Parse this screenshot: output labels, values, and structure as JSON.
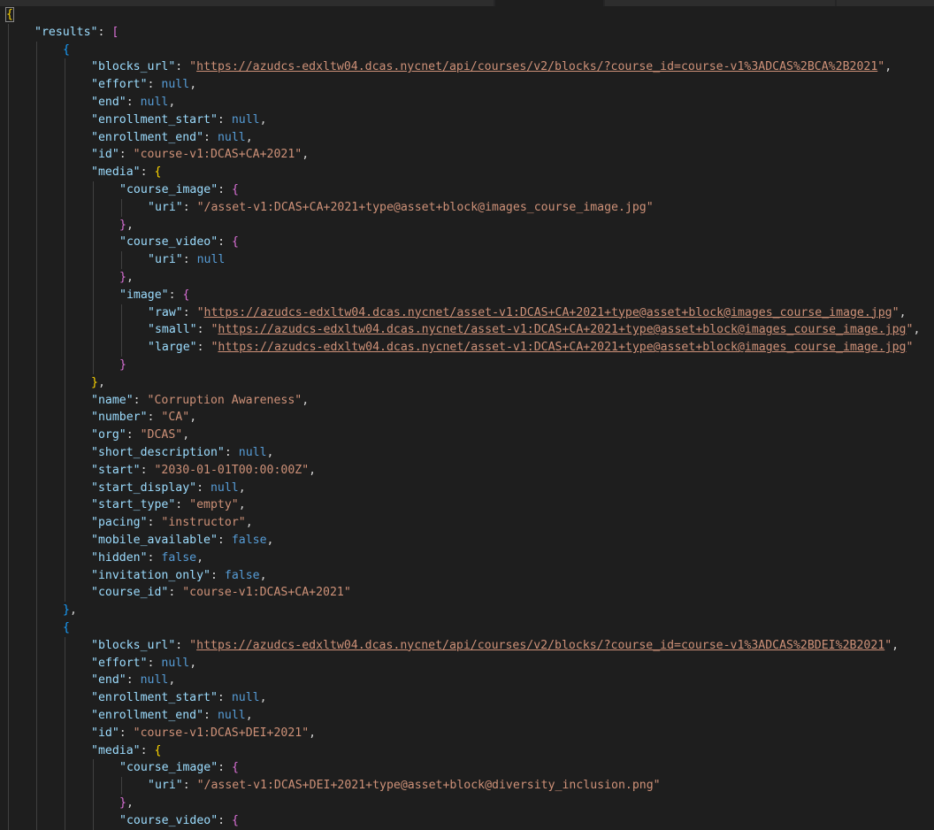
{
  "lines": [
    [
      [
        "b",
        "{"
      ]
    ],
    [
      [
        "k",
        "\"results\""
      ],
      [
        "p",
        ": "
      ],
      [
        "b2",
        "["
      ]
    ],
    [
      [
        "b3",
        "{"
      ]
    ],
    [
      [
        "k",
        "\"blocks_url\""
      ],
      [
        "p",
        ": "
      ],
      [
        "s",
        "\""
      ],
      [
        "su",
        "https://azudcs-edxltw04.dcas.nycnet/api/courses/v2/blocks/?course_id=course-v1%3ADCAS%2BCA%2B2021"
      ],
      [
        "s",
        "\""
      ],
      [
        "p",
        ","
      ]
    ],
    [
      [
        "k",
        "\"effort\""
      ],
      [
        "p",
        ": "
      ],
      [
        "n",
        "null"
      ],
      [
        "p",
        ","
      ]
    ],
    [
      [
        "k",
        "\"end\""
      ],
      [
        "p",
        ": "
      ],
      [
        "n",
        "null"
      ],
      [
        "p",
        ","
      ]
    ],
    [
      [
        "k",
        "\"enrollment_start\""
      ],
      [
        "p",
        ": "
      ],
      [
        "n",
        "null"
      ],
      [
        "p",
        ","
      ]
    ],
    [
      [
        "k",
        "\"enrollment_end\""
      ],
      [
        "p",
        ": "
      ],
      [
        "n",
        "null"
      ],
      [
        "p",
        ","
      ]
    ],
    [
      [
        "k",
        "\"id\""
      ],
      [
        "p",
        ": "
      ],
      [
        "s",
        "\"course-v1:DCAS+CA+2021\""
      ],
      [
        "p",
        ","
      ]
    ],
    [
      [
        "k",
        "\"media\""
      ],
      [
        "p",
        ": "
      ],
      [
        "b",
        "{"
      ]
    ],
    [
      [
        "k",
        "\"course_image\""
      ],
      [
        "p",
        ": "
      ],
      [
        "b2",
        "{"
      ]
    ],
    [
      [
        "k",
        "\"uri\""
      ],
      [
        "p",
        ": "
      ],
      [
        "s",
        "\"/asset-v1:DCAS+CA+2021+type@asset+block@images_course_image.jpg\""
      ]
    ],
    [
      [
        "b2",
        "}"
      ],
      [
        "p",
        ","
      ]
    ],
    [
      [
        "k",
        "\"course_video\""
      ],
      [
        "p",
        ": "
      ],
      [
        "b2",
        "{"
      ]
    ],
    [
      [
        "k",
        "\"uri\""
      ],
      [
        "p",
        ": "
      ],
      [
        "n",
        "null"
      ]
    ],
    [
      [
        "b2",
        "}"
      ],
      [
        "p",
        ","
      ]
    ],
    [
      [
        "k",
        "\"image\""
      ],
      [
        "p",
        ": "
      ],
      [
        "b2",
        "{"
      ]
    ],
    [
      [
        "k",
        "\"raw\""
      ],
      [
        "p",
        ": "
      ],
      [
        "s",
        "\""
      ],
      [
        "su",
        "https://azudcs-edxltw04.dcas.nycnet/asset-v1:DCAS+CA+2021+type@asset+block@images_course_image.jpg"
      ],
      [
        "s",
        "\""
      ],
      [
        "p",
        ","
      ]
    ],
    [
      [
        "k",
        "\"small\""
      ],
      [
        "p",
        ": "
      ],
      [
        "s",
        "\""
      ],
      [
        "su",
        "https://azudcs-edxltw04.dcas.nycnet/asset-v1:DCAS+CA+2021+type@asset+block@images_course_image.jpg"
      ],
      [
        "s",
        "\""
      ],
      [
        "p",
        ","
      ]
    ],
    [
      [
        "k",
        "\"large\""
      ],
      [
        "p",
        ": "
      ],
      [
        "s",
        "\""
      ],
      [
        "su",
        "https://azudcs-edxltw04.dcas.nycnet/asset-v1:DCAS+CA+2021+type@asset+block@images_course_image.jpg"
      ],
      [
        "s",
        "\""
      ]
    ],
    [
      [
        "b2",
        "}"
      ]
    ],
    [
      [
        "b",
        "}"
      ],
      [
        "p",
        ","
      ]
    ],
    [
      [
        "k",
        "\"name\""
      ],
      [
        "p",
        ": "
      ],
      [
        "s",
        "\"Corruption Awareness\""
      ],
      [
        "p",
        ","
      ]
    ],
    [
      [
        "k",
        "\"number\""
      ],
      [
        "p",
        ": "
      ],
      [
        "s",
        "\"CA\""
      ],
      [
        "p",
        ","
      ]
    ],
    [
      [
        "k",
        "\"org\""
      ],
      [
        "p",
        ": "
      ],
      [
        "s",
        "\"DCAS\""
      ],
      [
        "p",
        ","
      ]
    ],
    [
      [
        "k",
        "\"short_description\""
      ],
      [
        "p",
        ": "
      ],
      [
        "n",
        "null"
      ],
      [
        "p",
        ","
      ]
    ],
    [
      [
        "k",
        "\"start\""
      ],
      [
        "p",
        ": "
      ],
      [
        "s",
        "\"2030-01-01T00:00:00Z\""
      ],
      [
        "p",
        ","
      ]
    ],
    [
      [
        "k",
        "\"start_display\""
      ],
      [
        "p",
        ": "
      ],
      [
        "n",
        "null"
      ],
      [
        "p",
        ","
      ]
    ],
    [
      [
        "k",
        "\"start_type\""
      ],
      [
        "p",
        ": "
      ],
      [
        "s",
        "\"empty\""
      ],
      [
        "p",
        ","
      ]
    ],
    [
      [
        "k",
        "\"pacing\""
      ],
      [
        "p",
        ": "
      ],
      [
        "s",
        "\"instructor\""
      ],
      [
        "p",
        ","
      ]
    ],
    [
      [
        "k",
        "\"mobile_available\""
      ],
      [
        "p",
        ": "
      ],
      [
        "n",
        "false"
      ],
      [
        "p",
        ","
      ]
    ],
    [
      [
        "k",
        "\"hidden\""
      ],
      [
        "p",
        ": "
      ],
      [
        "n",
        "false"
      ],
      [
        "p",
        ","
      ]
    ],
    [
      [
        "k",
        "\"invitation_only\""
      ],
      [
        "p",
        ": "
      ],
      [
        "n",
        "false"
      ],
      [
        "p",
        ","
      ]
    ],
    [
      [
        "k",
        "\"course_id\""
      ],
      [
        "p",
        ": "
      ],
      [
        "s",
        "\"course-v1:DCAS+CA+2021\""
      ]
    ],
    [
      [
        "b3",
        "}"
      ],
      [
        "p",
        ","
      ]
    ],
    [
      [
        "b3",
        "{"
      ]
    ],
    [
      [
        "k",
        "\"blocks_url\""
      ],
      [
        "p",
        ": "
      ],
      [
        "s",
        "\""
      ],
      [
        "su",
        "https://azudcs-edxltw04.dcas.nycnet/api/courses/v2/blocks/?course_id=course-v1%3ADCAS%2BDEI%2B2021"
      ],
      [
        "s",
        "\""
      ],
      [
        "p",
        ","
      ]
    ],
    [
      [
        "k",
        "\"effort\""
      ],
      [
        "p",
        ": "
      ],
      [
        "n",
        "null"
      ],
      [
        "p",
        ","
      ]
    ],
    [
      [
        "k",
        "\"end\""
      ],
      [
        "p",
        ": "
      ],
      [
        "n",
        "null"
      ],
      [
        "p",
        ","
      ]
    ],
    [
      [
        "k",
        "\"enrollment_start\""
      ],
      [
        "p",
        ": "
      ],
      [
        "n",
        "null"
      ],
      [
        "p",
        ","
      ]
    ],
    [
      [
        "k",
        "\"enrollment_end\""
      ],
      [
        "p",
        ": "
      ],
      [
        "n",
        "null"
      ],
      [
        "p",
        ","
      ]
    ],
    [
      [
        "k",
        "\"id\""
      ],
      [
        "p",
        ": "
      ],
      [
        "s",
        "\"course-v1:DCAS+DEI+2021\""
      ],
      [
        "p",
        ","
      ]
    ],
    [
      [
        "k",
        "\"media\""
      ],
      [
        "p",
        ": "
      ],
      [
        "b",
        "{"
      ]
    ],
    [
      [
        "k",
        "\"course_image\""
      ],
      [
        "p",
        ": "
      ],
      [
        "b2",
        "{"
      ]
    ],
    [
      [
        "k",
        "\"uri\""
      ],
      [
        "p",
        ": "
      ],
      [
        "s",
        "\"/asset-v1:DCAS+DEI+2021+type@asset+block@diversity_inclusion.png\""
      ]
    ],
    [
      [
        "b2",
        "}"
      ],
      [
        "p",
        ","
      ]
    ],
    [
      [
        "k",
        "\"course_video\""
      ],
      [
        "p",
        ": "
      ],
      [
        "b2",
        "{"
      ]
    ]
  ]
}
